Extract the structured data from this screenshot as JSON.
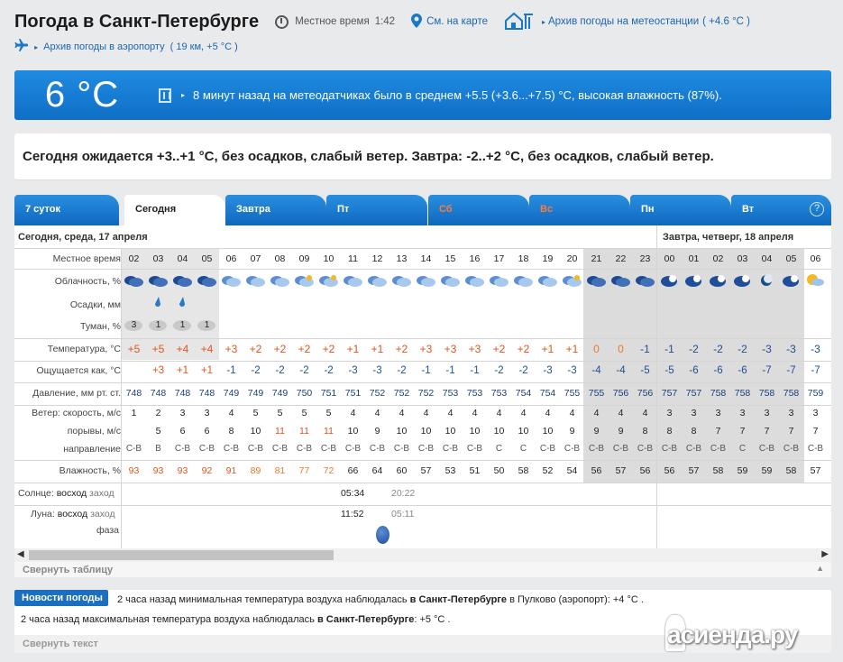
{
  "header": {
    "title": "Погода в Санкт-Петербурге",
    "local_time_label": "Местное время",
    "local_time": "1:42",
    "map_link": "См. на карте",
    "station_archive_link": "Архив погоды на метеостанции",
    "station_archive_temp": "( +4.6 °C )",
    "airport_archive_link": "Архив погоды в аэропорту",
    "airport_archive_info": "( 19 км, +5 °C )"
  },
  "banner": {
    "current_temp": "6 °C",
    "sensor_text": "8 минут назад на метеодатчиках было в среднем +5.5 (+3.6...+7.5) °C, высокая влажность (87%)."
  },
  "summary": "Сегодня ожидается +3..+1 °C, без осадков, слабый ветер. Завтра: -2..+2 °C, без осадков, слабый ветер.",
  "tabs": [
    {
      "label": "7 суток",
      "red": false,
      "active": false
    },
    {
      "label": "Сегодня",
      "red": false,
      "active": true
    },
    {
      "label": "Завтра",
      "red": false,
      "active": false
    },
    {
      "label": "Пт",
      "red": false,
      "active": false
    },
    {
      "label": "Сб",
      "red": true,
      "active": false
    },
    {
      "label": "Вс",
      "red": true,
      "active": false
    },
    {
      "label": "Пн",
      "red": false,
      "active": false
    },
    {
      "label": "Вт",
      "red": false,
      "active": false
    }
  ],
  "help_label": "?",
  "table": {
    "day1": "Сегодня, среда, 17 апреля",
    "day2": "Завтра, четверг, 18 апреля",
    "labels": {
      "time": "Местное время",
      "cloud": "Облачность, %",
      "precip": "Осадки, мм",
      "fog": "Туман, %",
      "temp": "Температура, °C",
      "feels": "Ощущается как, °C",
      "pressure": "Давление, мм рт. ст.",
      "wind": "Ветер: скорость, м/с",
      "gusts": "порывы, м/с",
      "direction": "направление",
      "humidity": "Влажность, %",
      "sun": "Солнце:",
      "sun_rise": "восход",
      "sun_set": "заход",
      "moon": "Луна:",
      "moon_rise": "восход",
      "moon_set": "заход",
      "phase": "фаза"
    },
    "hours": [
      "02",
      "03",
      "04",
      "05",
      "06",
      "07",
      "08",
      "09",
      "10",
      "11",
      "12",
      "13",
      "14",
      "15",
      "16",
      "17",
      "18",
      "19",
      "20",
      "21",
      "22",
      "23",
      "00",
      "01",
      "02",
      "03",
      "04",
      "05",
      "06"
    ],
    "fog": [
      "3",
      "1",
      "1",
      "1"
    ],
    "temps": [
      "+5",
      "+5",
      "+4",
      "+4",
      "+3",
      "+2",
      "+2",
      "+2",
      "+2",
      "+1",
      "+1",
      "+2",
      "+3",
      "+3",
      "+3",
      "+2",
      "+2",
      "+1",
      "+1",
      "0",
      "0",
      "-1",
      "-1",
      "-2",
      "-2",
      "-2",
      "-3",
      "-3",
      "-3"
    ],
    "feels": [
      "",
      "+3",
      "+1",
      "+1",
      "-1",
      "-2",
      "-2",
      "-2",
      "-2",
      "-3",
      "-3",
      "-2",
      "-1",
      "-1",
      "-1",
      "-2",
      "-2",
      "-3",
      "-3",
      "-4",
      "-4",
      "-5",
      "-5",
      "-6",
      "-6",
      "-6",
      "-7",
      "-7",
      "-7"
    ],
    "pressure": [
      "748",
      "748",
      "748",
      "748",
      "749",
      "749",
      "749",
      "750",
      "751",
      "751",
      "752",
      "752",
      "752",
      "753",
      "753",
      "753",
      "754",
      "754",
      "755",
      "755",
      "756",
      "756",
      "757",
      "757",
      "758",
      "758",
      "758",
      "758",
      "759"
    ],
    "wind": [
      "1",
      "2",
      "3",
      "3",
      "4",
      "5",
      "5",
      "5",
      "5",
      "4",
      "4",
      "4",
      "4",
      "4",
      "4",
      "4",
      "4",
      "4",
      "4",
      "4",
      "4",
      "4",
      "3",
      "3",
      "3",
      "3",
      "3",
      "3",
      "3"
    ],
    "gusts": [
      "",
      "5",
      "6",
      "6",
      "8",
      "10",
      "11",
      "11",
      "11",
      "10",
      "9",
      "10",
      "10",
      "10",
      "10",
      "10",
      "10",
      "10",
      "9",
      "9",
      "9",
      "8",
      "8",
      "8",
      "7",
      "7",
      "7",
      "7",
      "7"
    ],
    "direction": [
      "С-В",
      "В",
      "С-В",
      "С-В",
      "С-В",
      "С-В",
      "С-В",
      "С-В",
      "С-В",
      "С-В",
      "С-В",
      "С-В",
      "С-В",
      "С-В",
      "С-В",
      "С",
      "С",
      "С-В",
      "С-В",
      "С-В",
      "С-В",
      "С-В",
      "С-В",
      "С-В",
      "С-В",
      "С",
      "С-В",
      "С-В",
      "С-В"
    ],
    "humidity": [
      "93",
      "93",
      "93",
      "92",
      "91",
      "89",
      "81",
      "77",
      "72",
      "66",
      "64",
      "60",
      "57",
      "53",
      "51",
      "50",
      "58",
      "52",
      "54",
      "56",
      "57",
      "56",
      "56",
      "57",
      "58",
      "59",
      "59",
      "58",
      "57"
    ],
    "sun_rise_time": "05:34",
    "sun_set_time": "20:22",
    "moon_rise_time": "11:52",
    "moon_set_time": "05:11"
  },
  "collapse_table": "Свернуть таблицу",
  "news": {
    "badge": "Новости погоды",
    "line1_a": "2 часа назад минимальная температура воздуха наблюдалась",
    "line1_b": "в Санкт-Петербурге",
    "line1_c": "в Пулково (аэропорт): +4 °C .",
    "line2_a": "2 часа назад максимальная температура воздуха наблюдалась",
    "line2_b": "в Санкт-Петербурге",
    "line2_c": ": +5 °C ."
  },
  "collapse_text": "Свернуть текст",
  "watermark": "асиенда.ру",
  "colors": {
    "accent": "#1a78c8",
    "banner": "#1479d3",
    "warm": "#e2541b",
    "cold": "#1f4f8f",
    "night_band": "#dcdcdc"
  }
}
